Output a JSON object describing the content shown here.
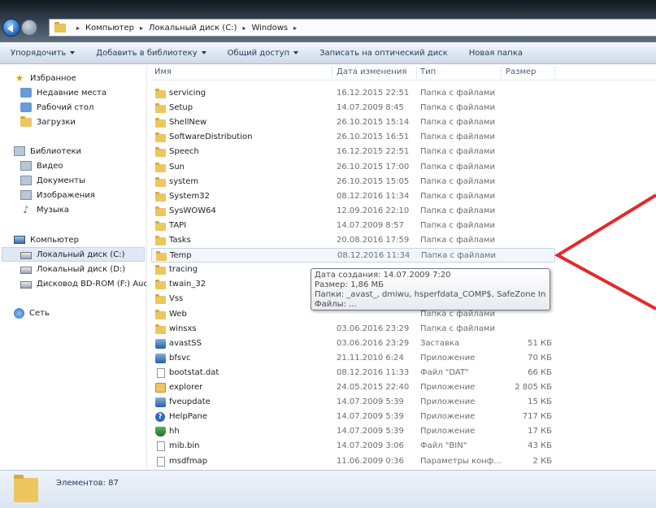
{
  "address": {
    "crumbs": [
      "Компьютер",
      "Локальный диск (C:)",
      "Windows"
    ]
  },
  "toolbar": {
    "organize": "Упорядочить",
    "add_to_library": "Добавить в библиотеку",
    "share": "Общий доступ",
    "burn": "Записать на оптический диск",
    "new_folder": "Новая папка"
  },
  "nav": {
    "favorites": "Избранное",
    "recent": "Недавние места",
    "desktop": "Рабочий стол",
    "downloads": "Загрузки",
    "libraries": "Библиотеки",
    "video": "Видео",
    "documents": "Документы",
    "images": "Изображения",
    "music": "Музыка",
    "computer": "Компьютер",
    "drive_c": "Локальный диск (C:)",
    "drive_d": "Локальный диск (D:)",
    "drive_f": "Дисковод BD-ROM (F:) Aud",
    "network": "Сеть"
  },
  "columns": {
    "name": "Имя",
    "date": "Дата изменения",
    "type": "Тип",
    "size": "Размер"
  },
  "files": [
    {
      "name": "servicing",
      "date": "16.12.2015 22:51",
      "type": "Папка с файлами",
      "size": "",
      "icon": "folder"
    },
    {
      "name": "Setup",
      "date": "14.07.2009 8:45",
      "type": "Папка с файлами",
      "size": "",
      "icon": "folder"
    },
    {
      "name": "ShellNew",
      "date": "26.10.2015 15:14",
      "type": "Папка с файлами",
      "size": "",
      "icon": "folder"
    },
    {
      "name": "SoftwareDistribution",
      "date": "26.10.2015 16:51",
      "type": "Папка с файлами",
      "size": "",
      "icon": "folder"
    },
    {
      "name": "Speech",
      "date": "16.12.2015 22:51",
      "type": "Папка с файлами",
      "size": "",
      "icon": "folder"
    },
    {
      "name": "Sun",
      "date": "26.10.2015 17:00",
      "type": "Папка с файлами",
      "size": "",
      "icon": "folder"
    },
    {
      "name": "system",
      "date": "26.10.2015 15:05",
      "type": "Папка с файлами",
      "size": "",
      "icon": "folder"
    },
    {
      "name": "System32",
      "date": "08.12.2016 11:34",
      "type": "Папка с файлами",
      "size": "",
      "icon": "folder"
    },
    {
      "name": "SysWOW64",
      "date": "12.09.2016 22:10",
      "type": "Папка с файлами",
      "size": "",
      "icon": "folder"
    },
    {
      "name": "TAPI",
      "date": "14.07.2009 8:57",
      "type": "Папка с файлами",
      "size": "",
      "icon": "folder"
    },
    {
      "name": "Tasks",
      "date": "20.08.2016 17:59",
      "type": "Папка с файлами",
      "size": "",
      "icon": "folder"
    },
    {
      "name": "Temp",
      "date": "08.12.2016 11:34",
      "type": "Папка с файлами",
      "size": "",
      "icon": "folder"
    },
    {
      "name": "tracing",
      "date": "",
      "type": "",
      "size": "",
      "icon": "folder"
    },
    {
      "name": "twain_32",
      "date": "",
      "type": "",
      "size": "",
      "icon": "folder"
    },
    {
      "name": "Vss",
      "date": "",
      "type": "",
      "size": "",
      "icon": "folder"
    },
    {
      "name": "Web",
      "date": "",
      "type": "Папка с файлами",
      "size": "",
      "icon": "folder"
    },
    {
      "name": "winsxs",
      "date": "03.06.2016 23:29",
      "type": "Папка с файлами",
      "size": "",
      "icon": "folder"
    },
    {
      "name": "avastSS",
      "date": "03.06.2016 23:29",
      "type": "Заставка",
      "size": "51 КБ",
      "icon": "app"
    },
    {
      "name": "bfsvc",
      "date": "21.11.2010 6:24",
      "type": "Приложение",
      "size": "70 КБ",
      "icon": "app"
    },
    {
      "name": "bootstat.dat",
      "date": "08.12.2016 11:33",
      "type": "Файл \"DAT\"",
      "size": "66 КБ",
      "icon": "doc"
    },
    {
      "name": "explorer",
      "date": "24.05.2015 22:40",
      "type": "Приложение",
      "size": "2 805 КБ",
      "icon": "explorer"
    },
    {
      "name": "fveupdate",
      "date": "14.07.2009 5:39",
      "type": "Приложение",
      "size": "15 КБ",
      "icon": "app"
    },
    {
      "name": "HelpPane",
      "date": "14.07.2009 5:39",
      "type": "Приложение",
      "size": "717 КБ",
      "icon": "help"
    },
    {
      "name": "hh",
      "date": "14.07.2009 5:39",
      "type": "Приложение",
      "size": "17 КБ",
      "icon": "shield"
    },
    {
      "name": "mib.bin",
      "date": "14.07.2009 3:06",
      "type": "Файл \"BIN\"",
      "size": "43 КБ",
      "icon": "doc"
    },
    {
      "name": "msdfmap",
      "date": "11.06.2009 0:36",
      "type": "Параметры конф...",
      "size": "2 КБ",
      "icon": "doc"
    }
  ],
  "tooltip": {
    "created": "Дата создания: 14.07.2009 7:20",
    "size": "Размер: 1,86 МБ",
    "folders": "Папки: _avast_, dmiwu, hsperfdata_COMP$, SafeZone Installer",
    "files": "Файлы: ..."
  },
  "status": {
    "items": "Элементов: 87"
  },
  "colors": {
    "annotation": "#e8272a",
    "selection": "#dfe8f4",
    "folder": "#ecc760"
  }
}
